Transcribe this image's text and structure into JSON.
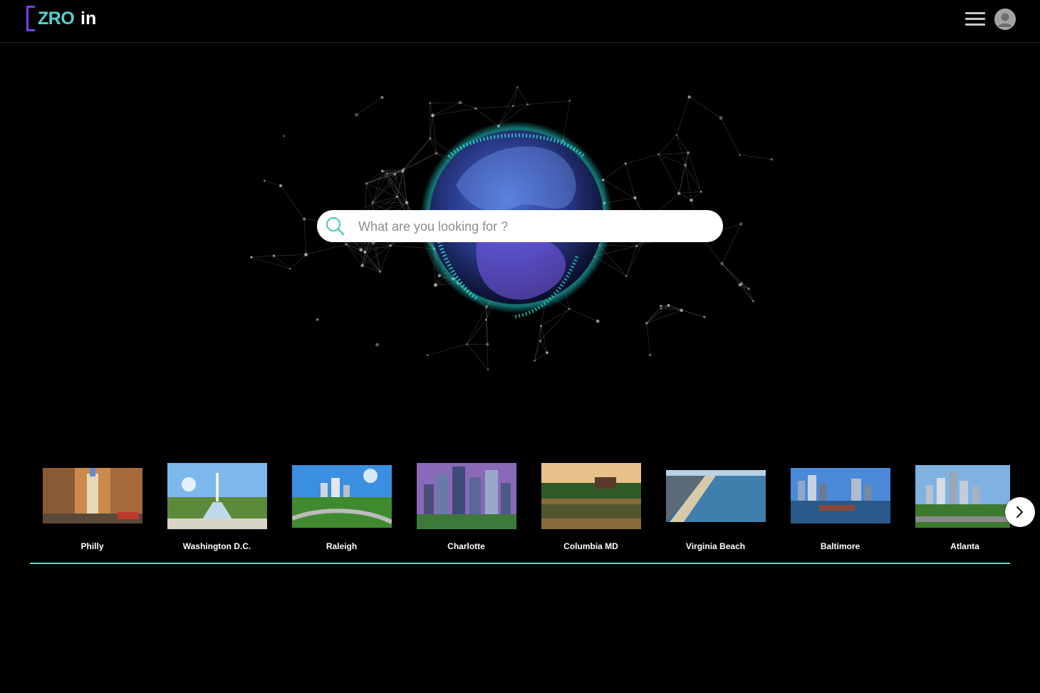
{
  "header": {
    "logo_main": "ZRO",
    "logo_suffix": "in",
    "menu_icon": "hamburger-icon",
    "avatar_icon": "user-avatar-icon"
  },
  "search": {
    "placeholder": "What are you looking for ?",
    "icon": "search-icon"
  },
  "cities": [
    {
      "name": "Philly"
    },
    {
      "name": "Washington D.C."
    },
    {
      "name": "Raleigh"
    },
    {
      "name": "Charlotte"
    },
    {
      "name": "Columbia MD"
    },
    {
      "name": "Virginia Beach"
    },
    {
      "name": "Baltimore"
    },
    {
      "name": "Atlanta"
    }
  ],
  "carousel": {
    "next_icon": "chevron-right-icon"
  },
  "colors": {
    "accent": "#6ed7d1",
    "brand_purple": "#7b3cf5",
    "background": "#000000"
  }
}
